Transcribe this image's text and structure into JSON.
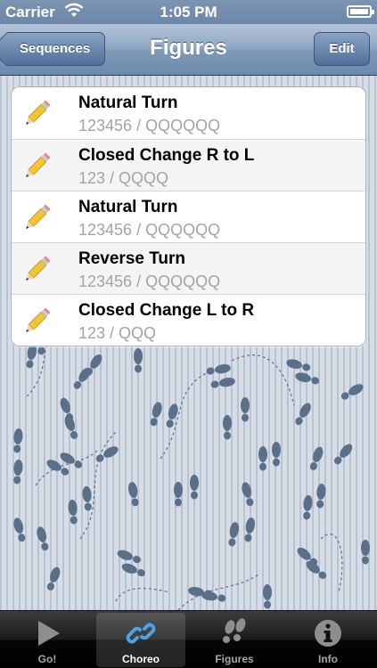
{
  "status_bar": {
    "carrier": "Carrier",
    "time": "1:05 PM"
  },
  "nav": {
    "title": "Figures",
    "back_label": "Sequences",
    "edit_label": "Edit"
  },
  "figures": [
    {
      "name": "Natural Turn",
      "detail": "123456 / QQQQQQ"
    },
    {
      "name": "Closed Change R to L",
      "detail": "123 / QQQQ"
    },
    {
      "name": "Natural Turn",
      "detail": "123456 / QQQQQQ"
    },
    {
      "name": "Reverse Turn",
      "detail": "123456 / QQQQQQ"
    },
    {
      "name": "Closed Change L to R",
      "detail": "123 / QQQ"
    }
  ],
  "tabs": [
    {
      "label": "Go!",
      "icon": "play-icon",
      "selected": false
    },
    {
      "label": "Choreo",
      "icon": "link-icon",
      "selected": true
    },
    {
      "label": "Figures",
      "icon": "footprints-icon",
      "selected": false
    },
    {
      "label": "Info",
      "icon": "info-icon",
      "selected": false
    }
  ],
  "colors": {
    "nav_blue": "#7f99b8",
    "tab_selected": "#ffffff",
    "footprint": "#5a6f88"
  }
}
